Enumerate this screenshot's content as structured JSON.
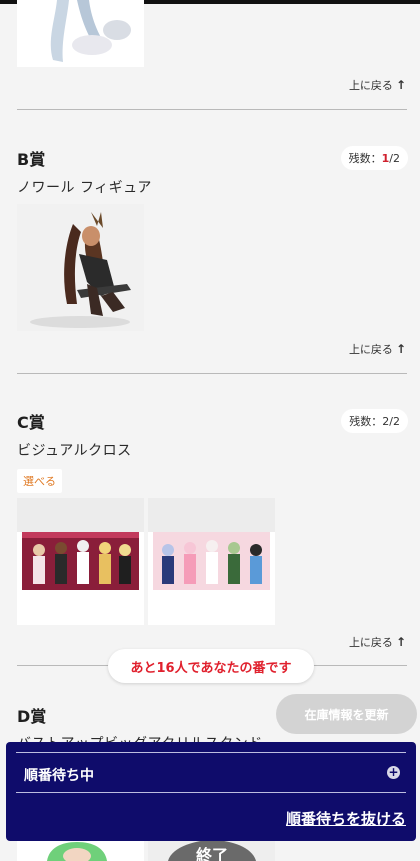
{
  "back_to_top": "上に戻る",
  "back_arrow": "↑",
  "prizes": [
    {
      "title": "B賞",
      "stock_label": "残数：",
      "stock_remaining": "1",
      "stock_total": "/2",
      "name": "ノワール フィギュア"
    },
    {
      "title": "C賞",
      "stock_label": "残数：",
      "stock_value": "2/2",
      "name": "ビジュアルクロス",
      "choose_label": "選べる"
    },
    {
      "title": "D賞",
      "name": "バストアップビッグアクリルスタンド",
      "overlay_label": "終了"
    }
  ],
  "queue": {
    "position_message": "あと16人であなたの番です",
    "refresh_label": "在庫情報を更新",
    "status_label": "順番待ち中",
    "expand_icon": "plus-icon",
    "leave_label": "順番待ちを抜ける"
  },
  "colors": {
    "accent_navy": "#0f0c6b",
    "alert_red": "#e0202d",
    "choose_orange": "#e07a24"
  }
}
